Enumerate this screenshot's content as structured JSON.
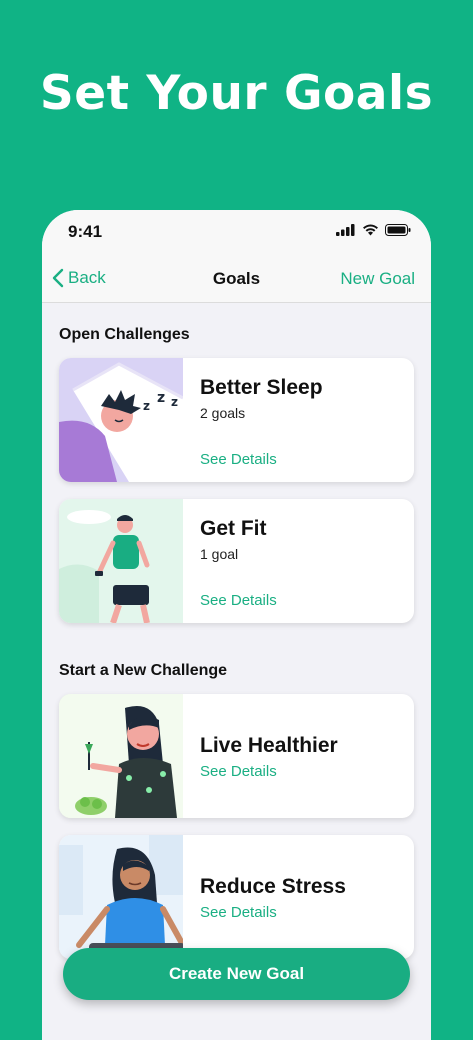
{
  "headline": "Set Your Goals",
  "status": {
    "time": "9:41"
  },
  "nav": {
    "back_label": "Back",
    "title": "Goals",
    "action_label": "New Goal"
  },
  "sections": {
    "open": "Open Challenges",
    "start": "Start a New Challenge"
  },
  "cards": [
    {
      "title": "Better Sleep",
      "subtitle": "2 goals",
      "link": "See Details",
      "icon": "sleeping-person-illustration"
    },
    {
      "title": "Get Fit",
      "subtitle": "1 goal",
      "link": "See Details",
      "icon": "walking-person-illustration"
    },
    {
      "title": "Live Healthier",
      "link": "See Details",
      "icon": "woman-eating-salad-illustration"
    },
    {
      "title": "Reduce Stress",
      "link": "See Details",
      "icon": "meditating-woman-illustration"
    }
  ],
  "cta": {
    "label": "Create New Goal"
  },
  "colors": {
    "brand": "#10b385",
    "accent": "#1aaf83"
  }
}
